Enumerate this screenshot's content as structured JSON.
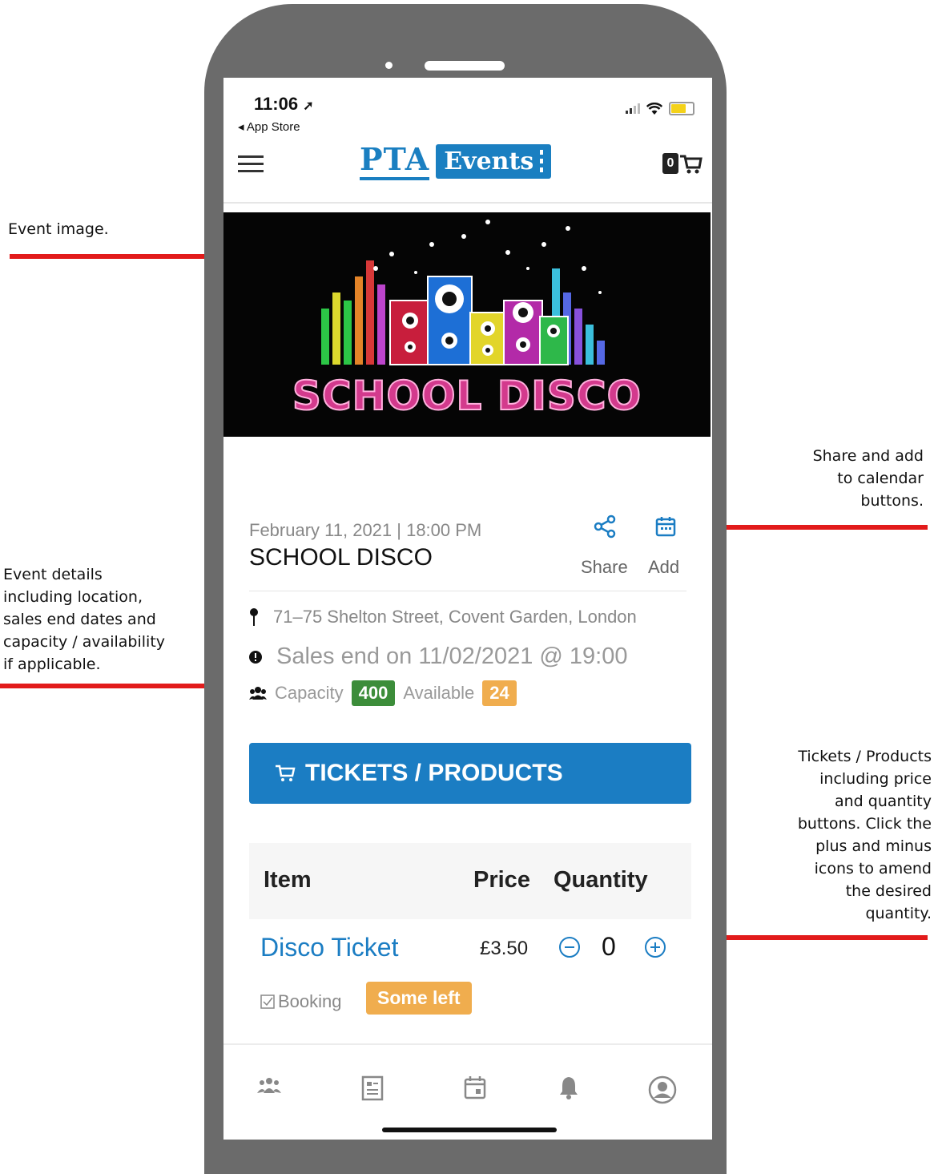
{
  "annotations": {
    "event_image": "Event image.",
    "share_add": [
      "Share and add",
      "to calendar",
      "buttons."
    ],
    "event_details": [
      "Event details",
      "including location,",
      "sales end dates and",
      "capacity / availability",
      "if applicable."
    ],
    "tickets": [
      "Tickets / Products",
      "including price",
      "and quantity",
      "buttons. Click the",
      "plus and minus",
      "icons to amend",
      "the desired",
      "quantity."
    ]
  },
  "status_bar": {
    "time": "11:06",
    "back_label": "App Store"
  },
  "header": {
    "logo_left": "PTA",
    "logo_right": "Events",
    "cart_count": "0"
  },
  "event": {
    "image_title": "SCHOOL DISCO",
    "date": "February 11, 2021 | 18:00 PM",
    "title": "SCHOOL DISCO",
    "share_label": "Share",
    "add_label": "Add",
    "location": "71–75 Shelton Street, Covent Garden, London",
    "sales_end": "Sales end on 11/02/2021 @ 19:00",
    "capacity_label": "Capacity",
    "capacity_value": "400",
    "available_label": "Available",
    "available_value": "24"
  },
  "tickets_button": "TICKETS / PRODUCTS",
  "table": {
    "headers": {
      "item": "Item",
      "price": "Price",
      "quantity": "Quantity"
    },
    "rows": [
      {
        "name": "Disco Ticket",
        "price": "£3.50",
        "quantity": "0"
      }
    ]
  },
  "booking": {
    "label": "Booking",
    "status": "Some left"
  },
  "tab_bar": {
    "icons": [
      "community-icon",
      "document-icon",
      "calendar-icon",
      "bell-icon",
      "profile-icon"
    ]
  },
  "colors": {
    "primary_blue": "#1b7dc3",
    "green_badge": "#3c8d3a",
    "orange_badge": "#f0ad4e",
    "arrow_red": "#e21b1b"
  }
}
